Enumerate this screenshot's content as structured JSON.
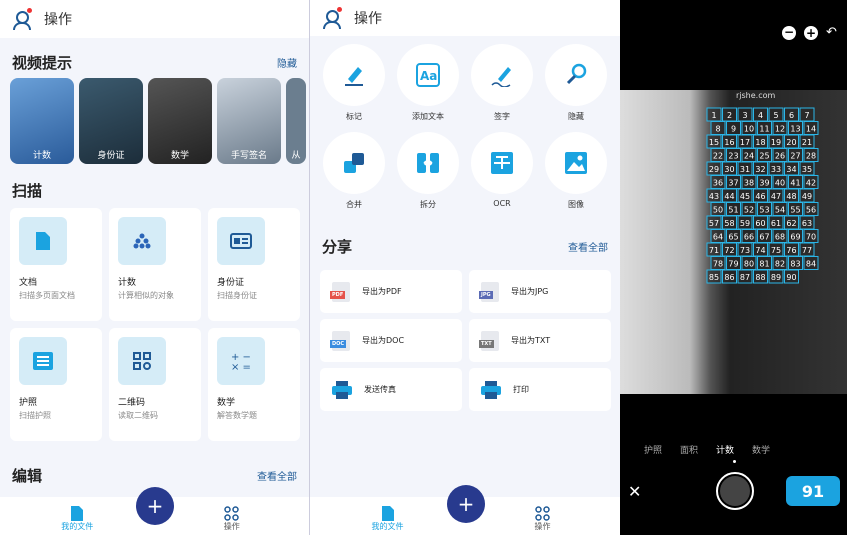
{
  "left": {
    "header_title": "操作",
    "video_section": {
      "title": "视频提示",
      "action": "隐藏",
      "items": [
        {
          "label": "计数"
        },
        {
          "label": "身份证"
        },
        {
          "label": "数学"
        },
        {
          "label": "手写签名"
        },
        {
          "label": "从"
        }
      ]
    },
    "scan_section": {
      "title": "扫描",
      "cards": [
        {
          "title": "文档",
          "subtitle": "扫描多页面文档",
          "icon": "document-icon"
        },
        {
          "title": "计数",
          "subtitle": "计算相似的对象",
          "icon": "count-icon"
        },
        {
          "title": "身份证",
          "subtitle": "扫描身份证",
          "icon": "id-card-icon"
        },
        {
          "title": "护照",
          "subtitle": "扫描护照",
          "icon": "passport-icon"
        },
        {
          "title": "二维码",
          "subtitle": "读取二维码",
          "icon": "qr-code-icon"
        },
        {
          "title": "数学",
          "subtitle": "解答数学题",
          "icon": "math-icon"
        }
      ]
    },
    "edit_section": {
      "title": "编辑",
      "action": "查看全部"
    },
    "nav": {
      "files": "我的文件",
      "actions": "操作",
      "fab": "+"
    }
  },
  "middle": {
    "header_title": "操作",
    "tools": [
      {
        "label": "标记",
        "icon": "marker-icon"
      },
      {
        "label": "添加文本",
        "icon": "add-text-icon"
      },
      {
        "label": "签字",
        "icon": "signature-icon"
      },
      {
        "label": "隐藏",
        "icon": "hide-icon"
      },
      {
        "label": "合并",
        "icon": "merge-icon"
      },
      {
        "label": "拆分",
        "icon": "split-icon"
      },
      {
        "label": "OCR",
        "icon": "ocr-icon"
      },
      {
        "label": "图像",
        "icon": "image-icon"
      }
    ],
    "share_section": {
      "title": "分享",
      "action": "查看全部",
      "items": [
        {
          "label": "导出为PDF",
          "badge": "PDF",
          "color": "#e5534b"
        },
        {
          "label": "导出为JPG",
          "badge": "JPG",
          "color": "#5b6bb5"
        },
        {
          "label": "导出为DOC",
          "badge": "DOC",
          "color": "#3b8de0"
        },
        {
          "label": "导出为TXT",
          "badge": "TXT",
          "color": "#777777"
        },
        {
          "label": "发送传真",
          "badge": "",
          "color": "#1ba3e0"
        },
        {
          "label": "打印",
          "badge": "",
          "color": "#1ba3e0"
        }
      ]
    },
    "nav": {
      "files": "我的文件",
      "actions": "操作",
      "fab": "+"
    }
  },
  "camera": {
    "watermark": "rjshe.com",
    "modes": [
      "护照",
      "面积",
      "计数",
      "数学"
    ],
    "active_mode": "计数",
    "count": "91",
    "labels": [
      "1",
      "2",
      "3",
      "4",
      "5",
      "6",
      "7",
      "8",
      "9",
      "10",
      "11",
      "12",
      "13",
      "14",
      "15",
      "16",
      "17",
      "18",
      "19",
      "20",
      "21",
      "22",
      "23",
      "24",
      "25",
      "26",
      "27",
      "28",
      "29",
      "30",
      "31",
      "32",
      "33",
      "34",
      "35",
      "36",
      "37",
      "38",
      "39",
      "40",
      "41",
      "42",
      "43",
      "44",
      "45",
      "46",
      "47",
      "48",
      "49",
      "50",
      "51",
      "52",
      "53",
      "54",
      "55",
      "56",
      "57",
      "58",
      "59",
      "60",
      "61",
      "62",
      "63",
      "64",
      "65",
      "66",
      "67",
      "68",
      "69",
      "70",
      "71",
      "72",
      "73",
      "74",
      "75",
      "76",
      "77",
      "78",
      "79",
      "80",
      "81",
      "82",
      "83",
      "84",
      "85",
      "86",
      "87",
      "88",
      "89",
      "90"
    ]
  },
  "colors": {
    "accent": "#1f5a96",
    "fab": "#283a8e",
    "icon": "#1ba3e0",
    "count_badge": "#1ba3e0"
  }
}
